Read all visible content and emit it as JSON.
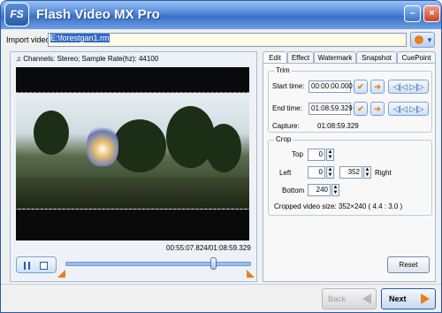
{
  "window": {
    "title": "Flash Video MX Pro",
    "logo_text": "FS"
  },
  "import": {
    "label": "Import video:",
    "path": "E:\\forestgan1.rm"
  },
  "preview": {
    "info": "Channels: Stereo;  Sample Rate(hz): 44100",
    "timecode": "00:55:07.824/01:08:59.329",
    "position_fraction": 0.8
  },
  "tabs": [
    {
      "label": "Edit",
      "active": true
    },
    {
      "label": "Effect",
      "active": false
    },
    {
      "label": "Watermark",
      "active": false
    },
    {
      "label": "Snapshot",
      "active": false
    },
    {
      "label": "CuePoint",
      "active": false
    }
  ],
  "trim": {
    "title": "Trim",
    "start_label": "Start time:",
    "start_value": "00:00:00.000",
    "end_label": "End time:",
    "end_value": "01:08:59.329",
    "capture_label": "Capture:",
    "capture_value": "01:08:59.329"
  },
  "crop": {
    "title": "Crop",
    "top_label": "Top",
    "top_value": "0",
    "left_label": "Left",
    "left_value": "0",
    "right_value": "352",
    "right_label": "Right",
    "bottom_label": "Bottom",
    "bottom_value": "240",
    "size_text": "Cropped video size: 352×240  ( 4.4 : 3.0 )"
  },
  "buttons": {
    "reset": "Reset",
    "back": "Back",
    "next": "Next"
  },
  "colors": {
    "accent": "#e8801c",
    "title_bar": "#4f86d8"
  }
}
